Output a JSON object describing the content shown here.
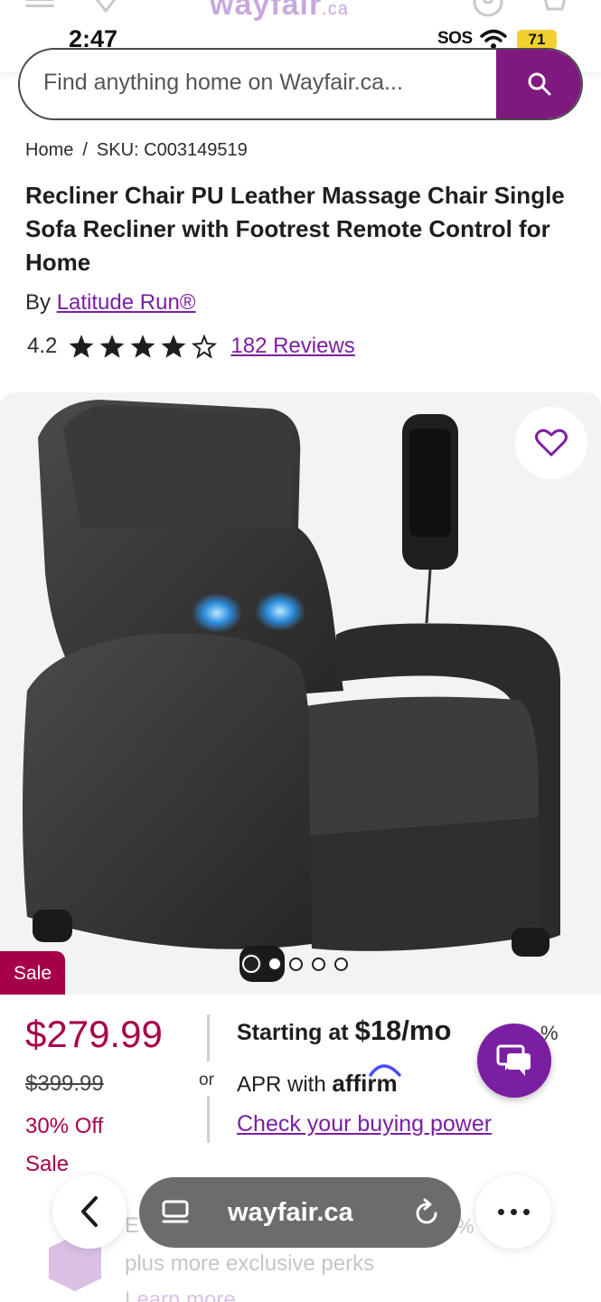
{
  "status_bar": {
    "time": "2:47",
    "sos": "SOS",
    "battery": "71"
  },
  "header": {
    "logo": "wayfair",
    "logo_suffix": ".ca"
  },
  "search": {
    "placeholder": "Find anything home on Wayfair.ca..."
  },
  "breadcrumb": {
    "home": "Home",
    "separator": "/",
    "sku": "SKU: C003149519"
  },
  "product": {
    "title": "Recliner Chair PU Leather Massage Chair Single Sofa Recliner with Footrest Remote Control for Home",
    "by_prefix": "By",
    "brand": "Latitude Run®",
    "rating": "4.2",
    "rating_value": 4.2,
    "stars_filled": 4,
    "stars_total": 5,
    "reviews": "182 Reviews"
  },
  "gallery": {
    "sale_tag": "Sale",
    "image_count": 5,
    "active_index": 0
  },
  "pricing": {
    "price": "$279.99",
    "was_price": "$399.99",
    "discount": "30% Off",
    "sale_label": "Sale",
    "or": "or",
    "starting_at": "Starting at",
    "monthly": "$18/mo",
    "apr_prefix": "APR with",
    "affirm": "affirm",
    "percent_fragment": "%",
    "buying_power": "Check your buying power"
  },
  "promo": {
    "line1": "E",
    "line2": "plus more exclusive perks",
    "line3": "Learn more",
    "pct": "%"
  },
  "browser": {
    "url": "wayfair.ca"
  },
  "colors": {
    "brand_purple": "#7b1fa2",
    "search_button": "#7f187f",
    "sale_red": "#a7004b",
    "battery_yellow": "#f2d12f"
  }
}
